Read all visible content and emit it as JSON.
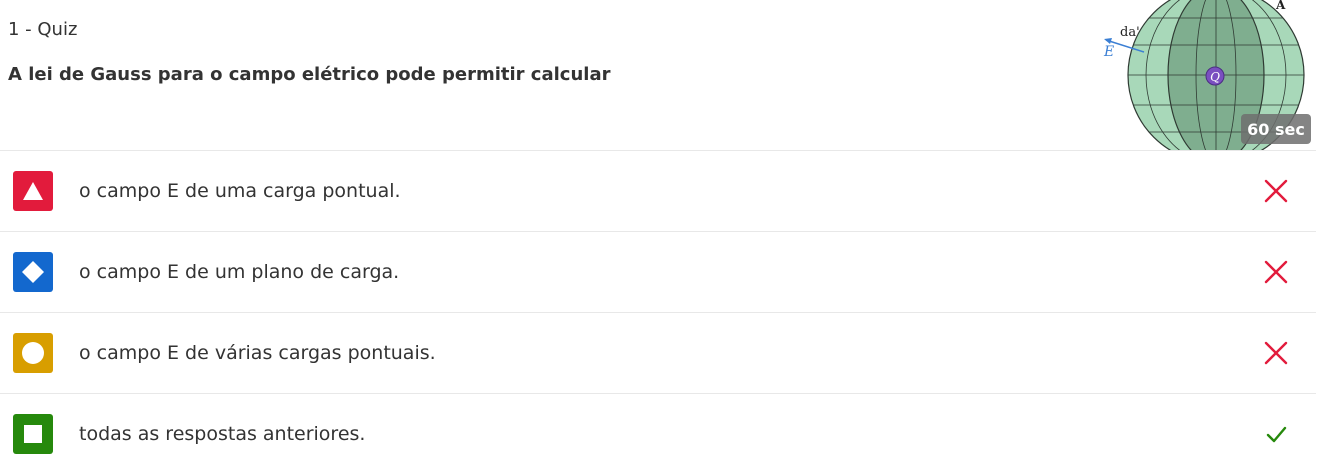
{
  "quiz": {
    "label": "1 - Quiz",
    "question": "A lei de Gauss para o campo elétrico pode permitir calcular",
    "timer": "60 sec",
    "figure": {
      "labels": {
        "area": "da'",
        "field": "E",
        "charge": "Q",
        "corner": "A"
      },
      "colors": {
        "sphere_outer": "#a8d8b9",
        "sphere_inner": "#7fae8f",
        "charge": "#7a4fc0",
        "vector": "#3b7fd4"
      }
    }
  },
  "answers": [
    {
      "text": "o campo E de uma carga pontual.",
      "shape": "triangle",
      "color": "#e21b3c",
      "result": "wrong",
      "result_icon": "x-mark-icon"
    },
    {
      "text": "o campo E de um plano de carga.",
      "shape": "diamond",
      "color": "#1368ce",
      "result": "wrong",
      "result_icon": "x-mark-icon"
    },
    {
      "text": "o campo E de várias cargas pontuais.",
      "shape": "circle",
      "color": "#d89e00",
      "result": "wrong",
      "result_icon": "x-mark-icon"
    },
    {
      "text": "todas as respostas anteriores.",
      "shape": "square",
      "color": "#26890c",
      "result": "correct",
      "result_icon": "check-icon"
    }
  ],
  "result_colors": {
    "wrong": "#e21b3c",
    "correct": "#26890c"
  }
}
